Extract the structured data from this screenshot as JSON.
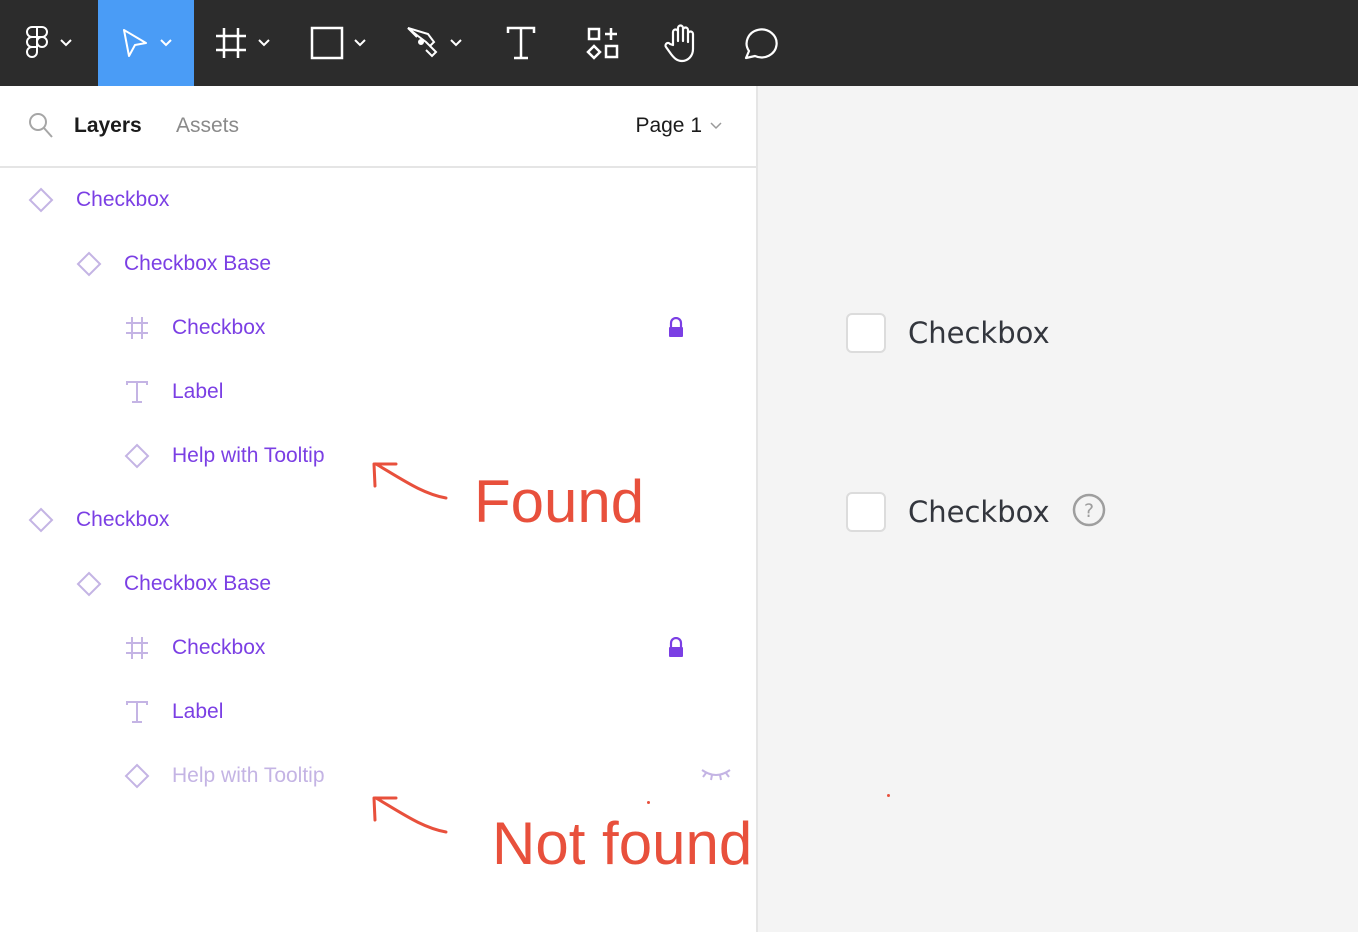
{
  "toolbar": {
    "tools": [
      {
        "name": "figma-menu",
        "icon": "figma-logo-icon",
        "has_dropdown": true,
        "active": false
      },
      {
        "name": "move",
        "icon": "move-arrow-icon",
        "has_dropdown": true,
        "active": true
      },
      {
        "name": "frame",
        "icon": "frame-grid-icon",
        "has_dropdown": true,
        "active": false
      },
      {
        "name": "shape",
        "icon": "rectangle-icon",
        "has_dropdown": true,
        "active": false
      },
      {
        "name": "pen",
        "icon": "pen-icon",
        "has_dropdown": true,
        "active": false
      },
      {
        "name": "text",
        "icon": "text-icon",
        "has_dropdown": false,
        "active": false
      },
      {
        "name": "resources",
        "icon": "components-icon",
        "has_dropdown": false,
        "active": false
      },
      {
        "name": "hand",
        "icon": "hand-icon",
        "has_dropdown": false,
        "active": false
      },
      {
        "name": "comment",
        "icon": "comment-icon",
        "has_dropdown": false,
        "active": false
      }
    ],
    "active_color": "#4a9cf6"
  },
  "panel": {
    "tabs": {
      "layers": "Layers",
      "assets": "Assets"
    },
    "page_selector": "Page 1",
    "layers": [
      {
        "name": "Checkbox",
        "type": "component-instance",
        "depth": 0,
        "locked": false,
        "hidden": false
      },
      {
        "name": "Checkbox Base",
        "type": "component-instance",
        "depth": 1,
        "locked": false,
        "hidden": false
      },
      {
        "name": "Checkbox",
        "type": "frame",
        "depth": 2,
        "locked": true,
        "hidden": false
      },
      {
        "name": "Label",
        "type": "text",
        "depth": 2,
        "locked": false,
        "hidden": false
      },
      {
        "name": "Help with Tooltip",
        "type": "component-instance",
        "depth": 2,
        "locked": false,
        "hidden": false
      },
      {
        "name": "Checkbox",
        "type": "component-instance",
        "depth": 0,
        "locked": false,
        "hidden": false
      },
      {
        "name": "Checkbox Base",
        "type": "component-instance",
        "depth": 1,
        "locked": false,
        "hidden": false
      },
      {
        "name": "Checkbox",
        "type": "frame",
        "depth": 2,
        "locked": true,
        "hidden": false
      },
      {
        "name": "Label",
        "type": "text",
        "depth": 2,
        "locked": false,
        "hidden": false
      },
      {
        "name": "Help with Tooltip",
        "type": "component-instance",
        "depth": 2,
        "locked": false,
        "hidden": true
      }
    ],
    "layer_color": "#7b3fe4"
  },
  "annotations": {
    "found": "Found",
    "not_found": "Not found",
    "color": "#e8503c"
  },
  "canvas": {
    "checkboxes": [
      {
        "label": "Checkbox",
        "checked": false,
        "help_icon": false
      },
      {
        "label": "Checkbox",
        "checked": false,
        "help_icon": true
      }
    ]
  }
}
